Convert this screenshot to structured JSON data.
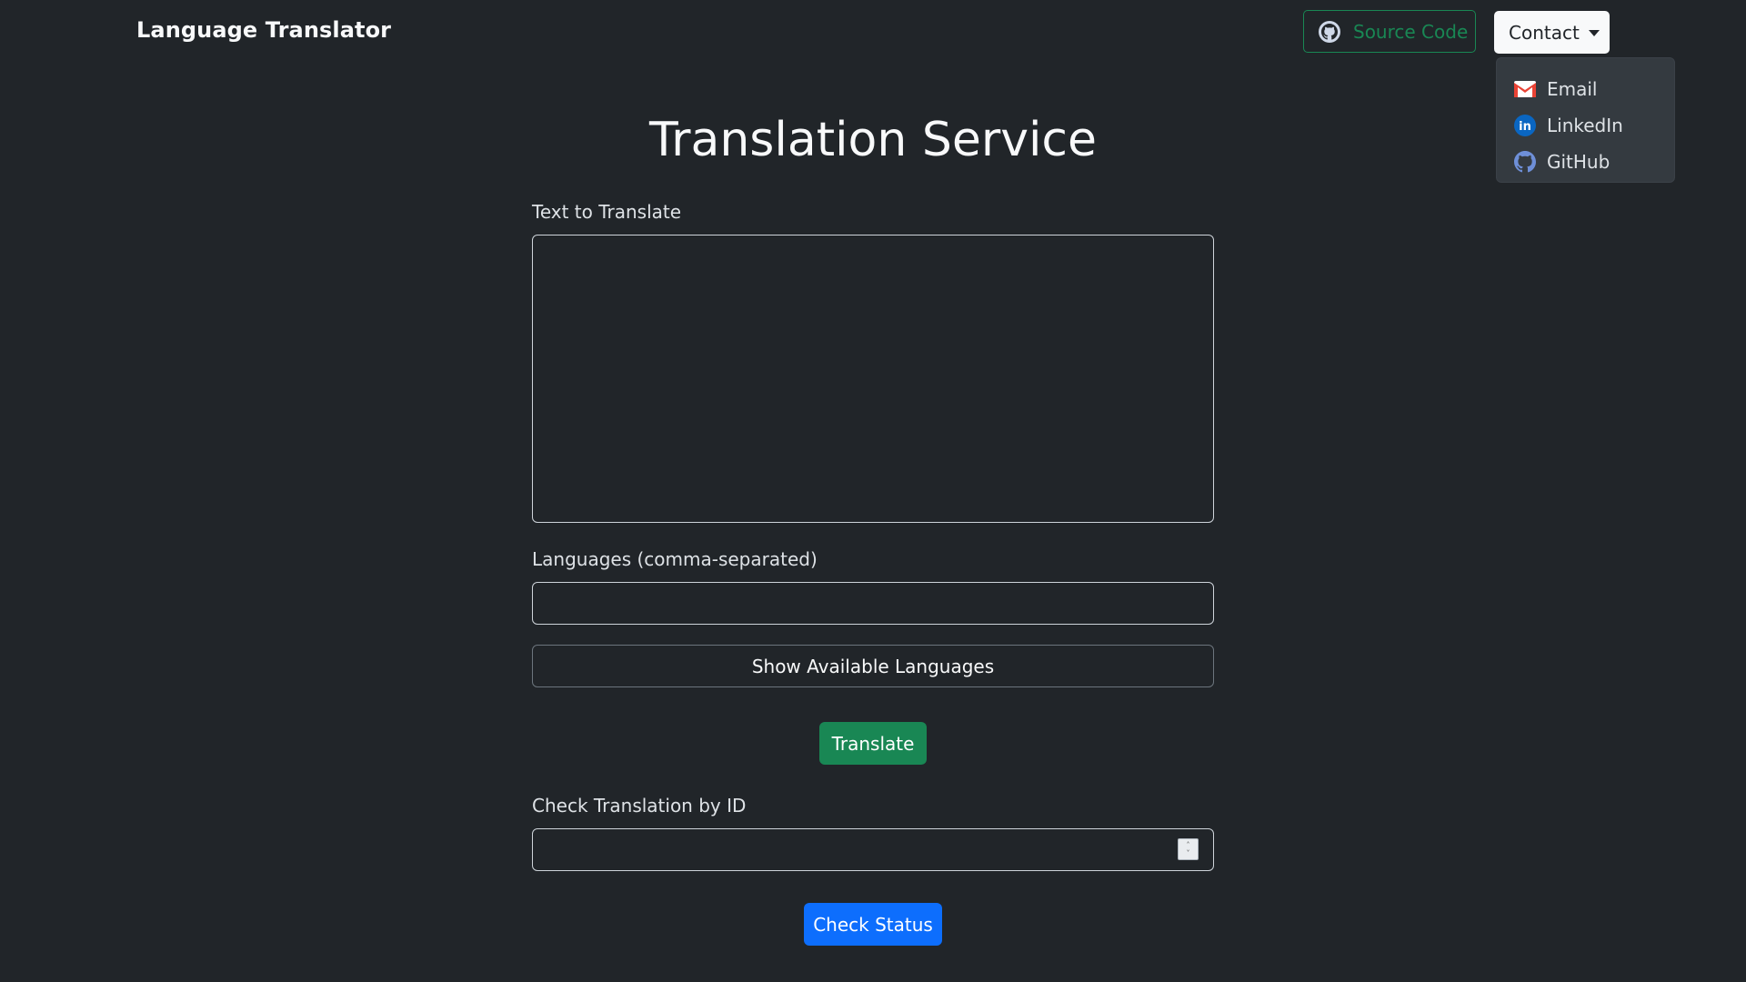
{
  "navbar": {
    "brand": "Language Translator",
    "source_code_label": "Source Code",
    "contact_label": "Contact"
  },
  "contact_menu": {
    "items": [
      {
        "label": "Email",
        "icon": "gmail-icon"
      },
      {
        "label": "LinkedIn",
        "icon": "linkedin-icon"
      },
      {
        "label": "GitHub",
        "icon": "github-icon"
      }
    ]
  },
  "main": {
    "title": "Translation Service",
    "text_label": "Text to Translate",
    "text_value": "",
    "languages_label": "Languages (comma-separated)",
    "languages_value": "",
    "show_languages_label": "Show Available Languages",
    "translate_label": "Translate",
    "check_label": "Check Translation by ID",
    "check_value": "",
    "check_status_label": "Check Status"
  },
  "colors": {
    "background": "#212529",
    "success": "#198754",
    "primary": "#0d6efd"
  }
}
